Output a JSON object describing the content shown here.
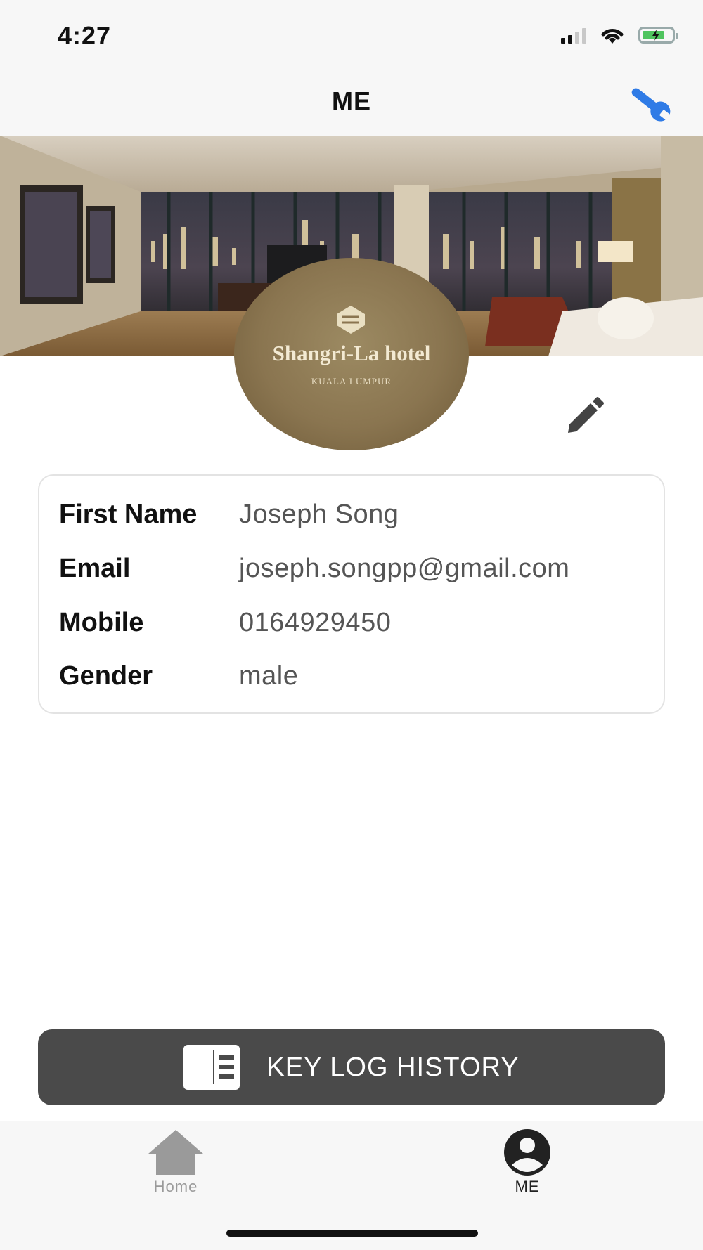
{
  "status_bar": {
    "time": "4:27"
  },
  "nav": {
    "title": "ME"
  },
  "avatar": {
    "brand": "Shangri-La hotel",
    "subtitle": "KUALA LUMPUR"
  },
  "profile": {
    "fields": [
      {
        "label": "First Name",
        "value": "Joseph Song"
      },
      {
        "label": "Email",
        "value": "joseph.songpp@gmail.com"
      },
      {
        "label": "Mobile",
        "value": "0164929450"
      },
      {
        "label": "Gender",
        "value": "male"
      }
    ]
  },
  "key_log_button": {
    "label": "KEY LOG HISTORY"
  },
  "tabs": [
    {
      "label": "Home",
      "icon": "home-icon",
      "active": false
    },
    {
      "label": "ME",
      "icon": "account-circle-icon",
      "active": true
    }
  ],
  "colors": {
    "accent": "#2f7be6",
    "button_bg": "#4a4a4a",
    "tab_inactive": "#9a9a9a",
    "tab_active": "#222222"
  }
}
